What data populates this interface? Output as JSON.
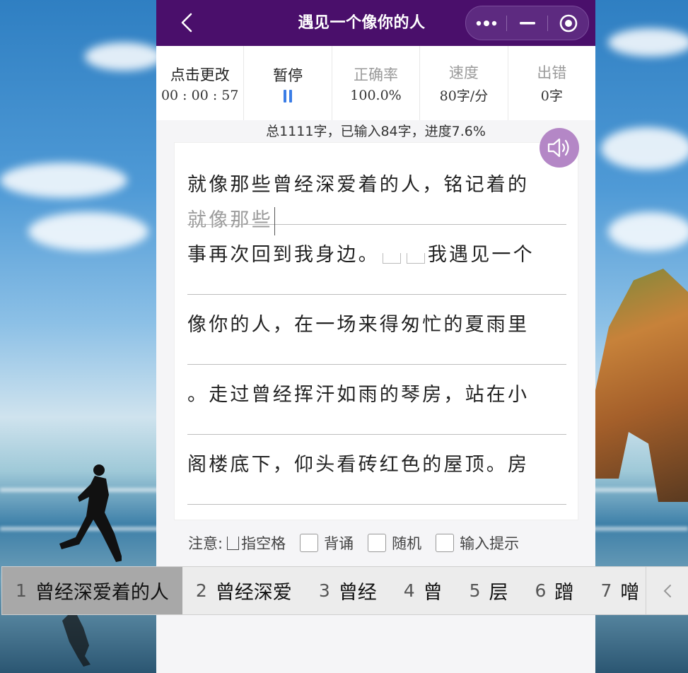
{
  "window": {
    "title": "遇见一个像你的人",
    "accent": "#4a0f6b"
  },
  "stats": {
    "change_label": "点击更改",
    "timer": "00 : 00 : 57",
    "pause_label": "暂停",
    "accuracy_label": "正确率",
    "accuracy_value": "100.0%",
    "speed_label": "速度",
    "speed_value": "80字/分",
    "error_label": "出错",
    "error_value": "0字"
  },
  "progress_text": "总1111字，已输入84字，进度7.6%",
  "article": {
    "lines": [
      {
        "text": "就像那些曾经深爱着的人，铭记着的",
        "typed": "就像那些"
      },
      {
        "text_before": "事再次回到我身边。",
        "text_after": "我遇见一个",
        "typed": ""
      },
      {
        "text": "像你的人，在一场来得匆忙的夏雨里",
        "typed": ""
      },
      {
        "text": "。走过曾经挥汗如雨的琴房，站在小",
        "typed": ""
      },
      {
        "text": "阁楼底下，仰头看砖红色的屋顶。房",
        "typed": ""
      }
    ]
  },
  "options": {
    "note_prefix": "注意:",
    "note_suffix": "指空格",
    "recite": "背诵",
    "random": "随机",
    "input_hint": "输入提示"
  },
  "candidates": [
    {
      "num": "1",
      "text": "曾经深爱着的人"
    },
    {
      "num": "2",
      "text": "曾经深爱"
    },
    {
      "num": "3",
      "text": "曾经"
    },
    {
      "num": "4",
      "text": "曾"
    },
    {
      "num": "5",
      "text": "层"
    },
    {
      "num": "6",
      "text": "蹭"
    },
    {
      "num": "7",
      "text": "噌"
    }
  ],
  "icons": {
    "back": "chevron-left-icon",
    "more": "more-dots-icon",
    "minimize": "minimize-icon",
    "close": "target-circle-icon",
    "speaker": "speaker-icon",
    "candidate_prev": "chevron-left-icon"
  }
}
